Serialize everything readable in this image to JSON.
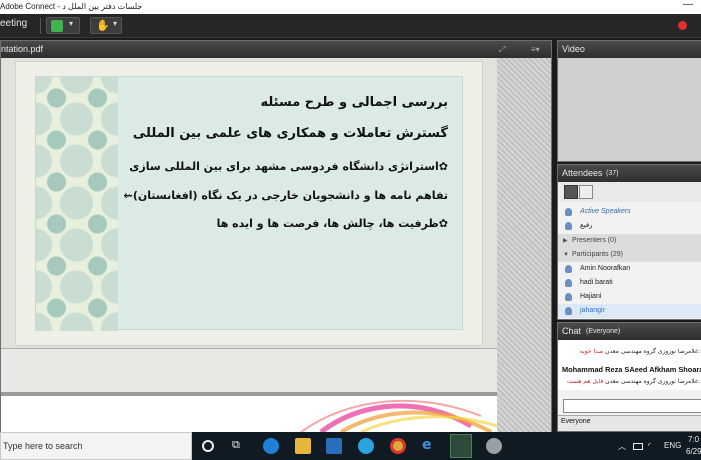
{
  "window": {
    "title": "Adobe Connect - جلسات دفتر بین الملل د",
    "minimize_glyph": "—"
  },
  "toolbar": {
    "meeting_label": "eeting",
    "audio_icon": "speaker-icon",
    "share_icon": "raise-hand-icon",
    "record_color": "#e0302b"
  },
  "share_pod": {
    "filename": "ntation.pdf",
    "slide_lines": [
      "بررسی اجمالی و طرح مسئله",
      "گسترش تعاملات و همکاری های علمی بین المللی",
      "✿استراتژی دانشگاه فردوسی مشهد برای بین المللی سازی",
      "تفاهم نامه ها و  دانشجویان خارجی در یک نگاه (افغانستان)⇜",
      "✿ظرفیت ها، چالش ها، فرصت ها و ایده ها"
    ]
  },
  "video_pod": {
    "title": "Video"
  },
  "attendees_pod": {
    "title": "Attendees",
    "count": "(37)",
    "active_speakers_label": "Active Speakers",
    "speaker_name": "رفیع",
    "presenters_label": "Presenters (0)",
    "participants_label": "Participants (29)",
    "participants": [
      "Amin Noorafkan",
      "hadi barati",
      "Hajiani",
      "jahangir"
    ]
  },
  "chat_pod": {
    "title": "Chat",
    "scope": "(Everyone)",
    "messages": [
      {
        "text": ":غلامرضا نوروزی گروه مهندسی معدن",
        "who": "صدا خوبه"
      },
      {
        "text": ":غلامرضا نوروزی گروه مهندسی معدن",
        "who": "فایل هم هست"
      }
    ],
    "bold_line": "Mohammad Reza SAeed Afkham Shoara",
    "target_button": "Everyone"
  },
  "taskbar": {
    "search_placeholder": "Type here to search",
    "language": "ENG",
    "time": "7:0",
    "date": "6/29"
  },
  "colors": {
    "chrome_dark": "#262626",
    "pod_header": "#3c3c3c",
    "accent_blue": "#2f6fd1"
  }
}
